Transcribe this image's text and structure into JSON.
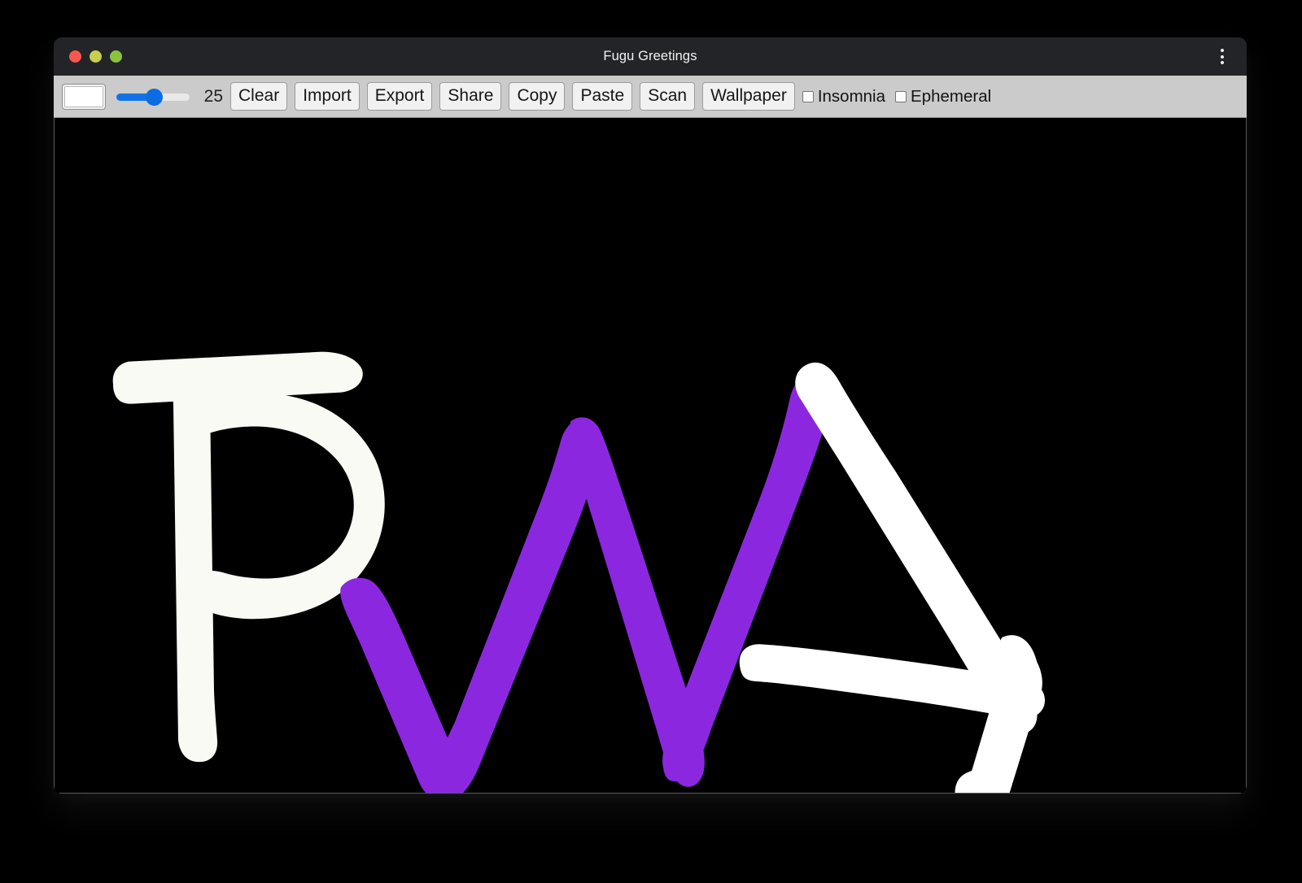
{
  "window": {
    "title": "Fugu Greetings",
    "traffic_lights": [
      "close",
      "minimize",
      "maximize"
    ],
    "menu_icon": "kebab-menu-icon"
  },
  "toolbar": {
    "color_swatch": {
      "icon": "color-swatch-icon",
      "value": "#ffffff"
    },
    "brush_slider": {
      "icon": "slider-icon",
      "value": 25,
      "min": 1,
      "max": 50,
      "fill_color": "#1373e6"
    },
    "brush_size_label": "25",
    "buttons": [
      {
        "label": "Clear",
        "name": "clear-button"
      },
      {
        "label": "Import",
        "name": "import-button"
      },
      {
        "label": "Export",
        "name": "export-button"
      },
      {
        "label": "Share",
        "name": "share-button"
      },
      {
        "label": "Copy",
        "name": "copy-button"
      },
      {
        "label": "Paste",
        "name": "paste-button"
      },
      {
        "label": "Scan",
        "name": "scan-button"
      },
      {
        "label": "Wallpaper",
        "name": "wallpaper-button"
      }
    ],
    "checkboxes": [
      {
        "label": "Insomnia",
        "checked": false,
        "name": "insomnia-checkbox"
      },
      {
        "label": "Ephemeral",
        "checked": false,
        "name": "ephemeral-checkbox"
      }
    ]
  },
  "canvas": {
    "background_color": "#000000",
    "strokes": [
      {
        "letter": "P",
        "color": "#f9faf4"
      },
      {
        "letter": "W",
        "color": "#8b28df"
      },
      {
        "letter": "A",
        "color": "#ffffff"
      }
    ],
    "drawn_text": "PWA"
  }
}
